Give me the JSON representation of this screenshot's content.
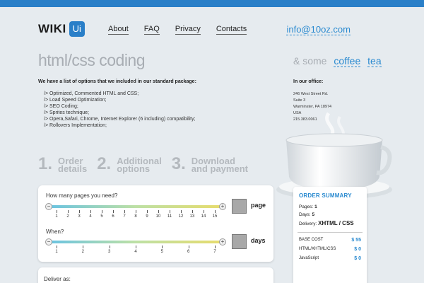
{
  "logo": {
    "text": "WIKI",
    "badge": "Ui"
  },
  "nav": [
    "About",
    "FAQ",
    "Privacy",
    "Contacts"
  ],
  "contact_email": "info@10oz.com",
  "hero": {
    "title": "html/css coding",
    "tagline_prefix": "& some",
    "tagline_word1": "coffee",
    "tagline_word2": "tea"
  },
  "intro": "We have a list of options that we included in our standard package:",
  "features": [
    "/> Optimized, Commented HTML and CSS;",
    "/> Load Speed Optimization;",
    "/> SEO Coding;",
    "/> Sprites technique;",
    "/> Opera,Safari, Chrome, Internet Explorer (6 including) compatibility;",
    "/> Rollovers Implementation;"
  ],
  "office": {
    "title": "In our office:",
    "lines": [
      "246 West Street Rd.",
      "Suite 3",
      "Warminster, PA 18974",
      "USA",
      "215.383.0061"
    ]
  },
  "steps": [
    {
      "num": "1.",
      "line1": "Order",
      "line2": "details"
    },
    {
      "num": "2.",
      "line1": "Additional",
      "line2": "options"
    },
    {
      "num": "3.",
      "line1": "Download",
      "line2": "and payment"
    }
  ],
  "form": {
    "pages_question": "How many pages you need?",
    "pages_ticks": [
      "1",
      "2",
      "3",
      "4",
      "5",
      "6",
      "7",
      "8",
      "9",
      "10",
      "11",
      "12",
      "13",
      "14",
      "15"
    ],
    "pages_unit": "page",
    "days_question": "When?",
    "days_ticks": [
      "1",
      "2",
      "3",
      "4",
      "5",
      "6",
      "7"
    ],
    "days_unit": "days",
    "deliver_label": "Deliver as:"
  },
  "summary": {
    "title": "ORDER SUMMARY",
    "pages_label": "Pages:",
    "pages_value": "1",
    "days_label": "Days:",
    "days_value": "5",
    "delivery_label": "Delivery:",
    "delivery_value": "XHTML / CSS",
    "costs": [
      {
        "label": "BASE COST",
        "price": "$ 55"
      },
      {
        "label": "HTML/XHTML/CSS",
        "price": "$ 0"
      },
      {
        "label": "JavaScript",
        "price": "$ 0"
      }
    ]
  },
  "colors": {
    "accent": "#2a7fc8",
    "link": "#2a8ad0",
    "background": "#e6ebef",
    "muted": "#a8adb3"
  }
}
